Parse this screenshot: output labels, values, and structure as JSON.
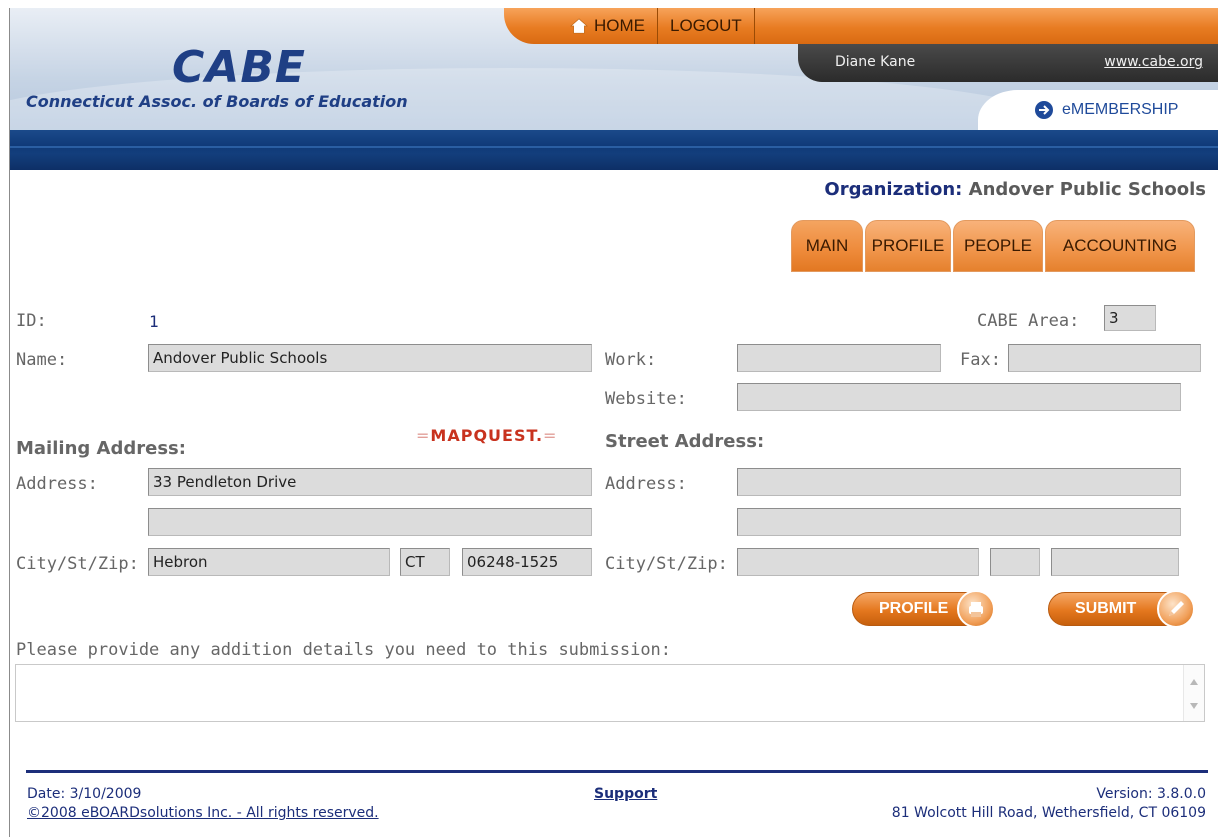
{
  "header": {
    "brand": "CABE",
    "tagline": "Connecticut Assoc. of Boards of Education",
    "nav": {
      "home": "HOME",
      "logout": "LOGOUT"
    },
    "user_name": "Diane Kane",
    "site_link": "www.cabe.org",
    "emembership": "eMEMBERSHIP"
  },
  "organization": {
    "label": "Organization:",
    "name": "Andover Public Schools"
  },
  "tabs": [
    {
      "label": "MAIN",
      "active": true
    },
    {
      "label": "PROFILE"
    },
    {
      "label": "PEOPLE"
    },
    {
      "label": "ACCOUNTING"
    }
  ],
  "form": {
    "id": {
      "label": "ID:",
      "value": "1"
    },
    "cabe_area": {
      "label": "CABE Area:",
      "value": "3"
    },
    "name": {
      "label": "Name:",
      "value": "Andover Public Schools"
    },
    "work": {
      "label": "Work:",
      "value": ""
    },
    "fax": {
      "label": "Fax:",
      "value": ""
    },
    "website": {
      "label": "Website:",
      "value": ""
    },
    "mailing": {
      "title": "Mailing Address:",
      "address_label": "Address:",
      "address1": "33 Pendleton Drive",
      "address2": "",
      "csz_label": "City/St/Zip:",
      "city": "Hebron",
      "state": "CT",
      "zip": "06248-1525"
    },
    "mapquest": "MAPQUEST.",
    "street": {
      "title": "Street Address:",
      "address_label": "Address:",
      "address1": "",
      "address2": "",
      "csz_label": "City/St/Zip:",
      "city": "",
      "state": "",
      "zip": ""
    }
  },
  "buttons": {
    "profile": "PROFILE",
    "submit": "SUBMIT"
  },
  "details": {
    "label": "Please provide any addition details you need to this submission:",
    "value": ""
  },
  "footer": {
    "date": "Date: 3/10/2009",
    "copyright": "©2008 eBOARDsolutions Inc. - All rights reserved.",
    "support": "Support",
    "version": "Version: 3.8.0.0",
    "address": "81 Wolcott Hill Road, Wethersfield, CT 06109"
  },
  "colors": {
    "accent_orange": "#e87c22",
    "navy": "#1c2e7a",
    "band_blue": "#133e7c"
  }
}
